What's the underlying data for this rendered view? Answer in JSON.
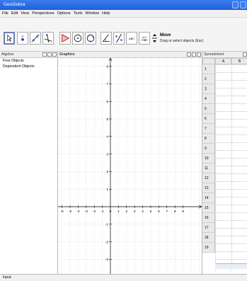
{
  "window": {
    "title": "GeoGebra"
  },
  "menu": [
    "File",
    "Edit",
    "View",
    "Perspectives",
    "Options",
    "Tools",
    "Window",
    "Help"
  ],
  "toolbar": {
    "tools": [
      "move-tool",
      "point-tool",
      "line-tool",
      "perpendicular-line-tool",
      "polygon-tool",
      "circle-tool",
      "circle-three-points-tool",
      "angle-tool",
      "reflect-tool",
      "text-tool",
      "slider-tool",
      "move-graphics-view-tool"
    ],
    "tool_text": {
      "text-tool": "ABC",
      "slider-tool": "a=2"
    },
    "selected_tool_name": "Move",
    "selected_tool_help": "Drag or select objects (Esc)"
  },
  "algebra": {
    "header": "Algebra",
    "items": [
      "Free Objects",
      "Dependent Objects"
    ]
  },
  "graphics": {
    "header": "Graphics",
    "x_ticks": [
      "-8",
      "-7",
      "-6",
      "-5",
      "-4",
      "-3",
      "-2",
      "-1",
      "0",
      "1",
      "2",
      "3",
      "4",
      "5",
      "6",
      "7",
      "8",
      "9"
    ],
    "x_tick_values": [
      -8,
      -7,
      -6,
      -5,
      -4,
      -3,
      -2,
      -1,
      0,
      1,
      2,
      3,
      4,
      5,
      6,
      7,
      8,
      9
    ],
    "y_ticks": [
      "8",
      "7",
      "6",
      "5",
      "4",
      "3",
      "2",
      "1",
      "-1",
      "-2",
      "-3"
    ],
    "y_tick_values": [
      8,
      7,
      6,
      5,
      4,
      3,
      2,
      1,
      -1,
      -2,
      -3
    ],
    "grid": true
  },
  "spreadsheet": {
    "header": "Spreadsheet",
    "columns": [
      "A",
      "B"
    ],
    "rows": [
      "1",
      "2",
      "3",
      "4",
      "5",
      "6",
      "7",
      "8",
      "9",
      "10",
      "11",
      "12",
      "13",
      "14",
      "15",
      "16",
      "17",
      "18",
      "19"
    ]
  },
  "input": {
    "label": "Input:"
  }
}
